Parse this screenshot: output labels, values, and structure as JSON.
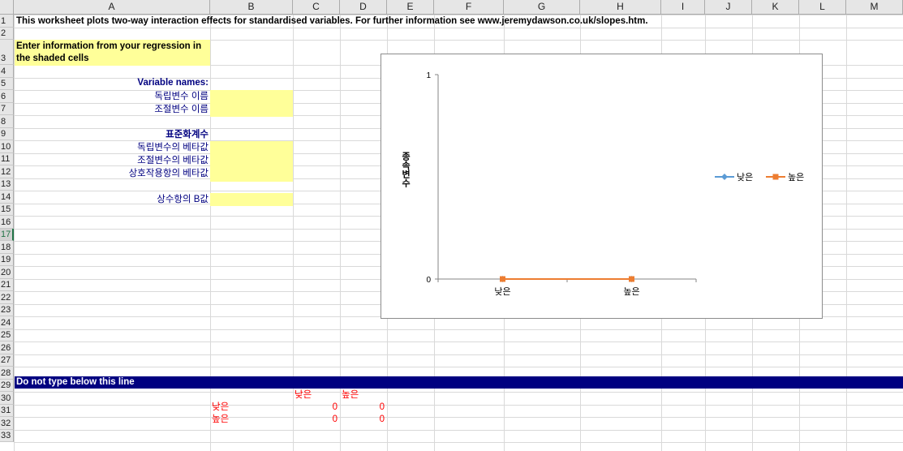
{
  "columns": [
    "A",
    "B",
    "C",
    "D",
    "E",
    "F",
    "G",
    "H",
    "I",
    "J",
    "K",
    "L",
    "M"
  ],
  "rows": [
    "1",
    "2",
    "3",
    "4",
    "5",
    "6",
    "7",
    "8",
    "9",
    "10",
    "11",
    "12",
    "13",
    "14",
    "15",
    "16",
    "17",
    "18",
    "19",
    "20",
    "21",
    "22",
    "23",
    "24",
    "25",
    "26",
    "27",
    "28",
    "29",
    "30",
    "31",
    "32",
    "33"
  ],
  "selected_row": "17",
  "cells": {
    "intro": "This worksheet plots two-way interaction effects for standardised variables. For further information see www.jeremydawson.co.uk/slopes.htm.",
    "enter_info": "Enter information from your regression in the shaded cells",
    "variable_names": "Variable names:",
    "iv_name": "독립변수 이름",
    "mod_name": "조절변수 이름",
    "std_coef": "표준화계수",
    "iv_beta": "독립변수의 베타값",
    "mod_beta": "조절변수의 베타값",
    "int_beta": "상호작용항의 베타값",
    "const_b": "상수항의 B값",
    "do_not_type": "Do not type below this line",
    "tbl_head_low": "낮은",
    "tbl_head_high": "높은",
    "tbl_row_low": "낮은",
    "tbl_row_high": "높은",
    "v_c31": "0",
    "v_d31": "0",
    "v_c32": "0",
    "v_d32": "0"
  },
  "colors": {
    "yellow": "#ffff99",
    "navy_band": "#000080",
    "series_low": "#5b9bd5",
    "series_high": "#ed7d31"
  },
  "chart_data": {
    "type": "line",
    "categories": [
      "낮은",
      "높은"
    ],
    "series": [
      {
        "name": "낮은",
        "values": [
          0,
          0
        ],
        "color": "#5b9bd5",
        "marker": "diamond"
      },
      {
        "name": "높은",
        "values": [
          0,
          0
        ],
        "color": "#ed7d31",
        "marker": "square"
      }
    ],
    "ylabel": "종속변수",
    "ylim": [
      0,
      1
    ],
    "yticks": [
      "0",
      "1"
    ],
    "legend": "right"
  }
}
